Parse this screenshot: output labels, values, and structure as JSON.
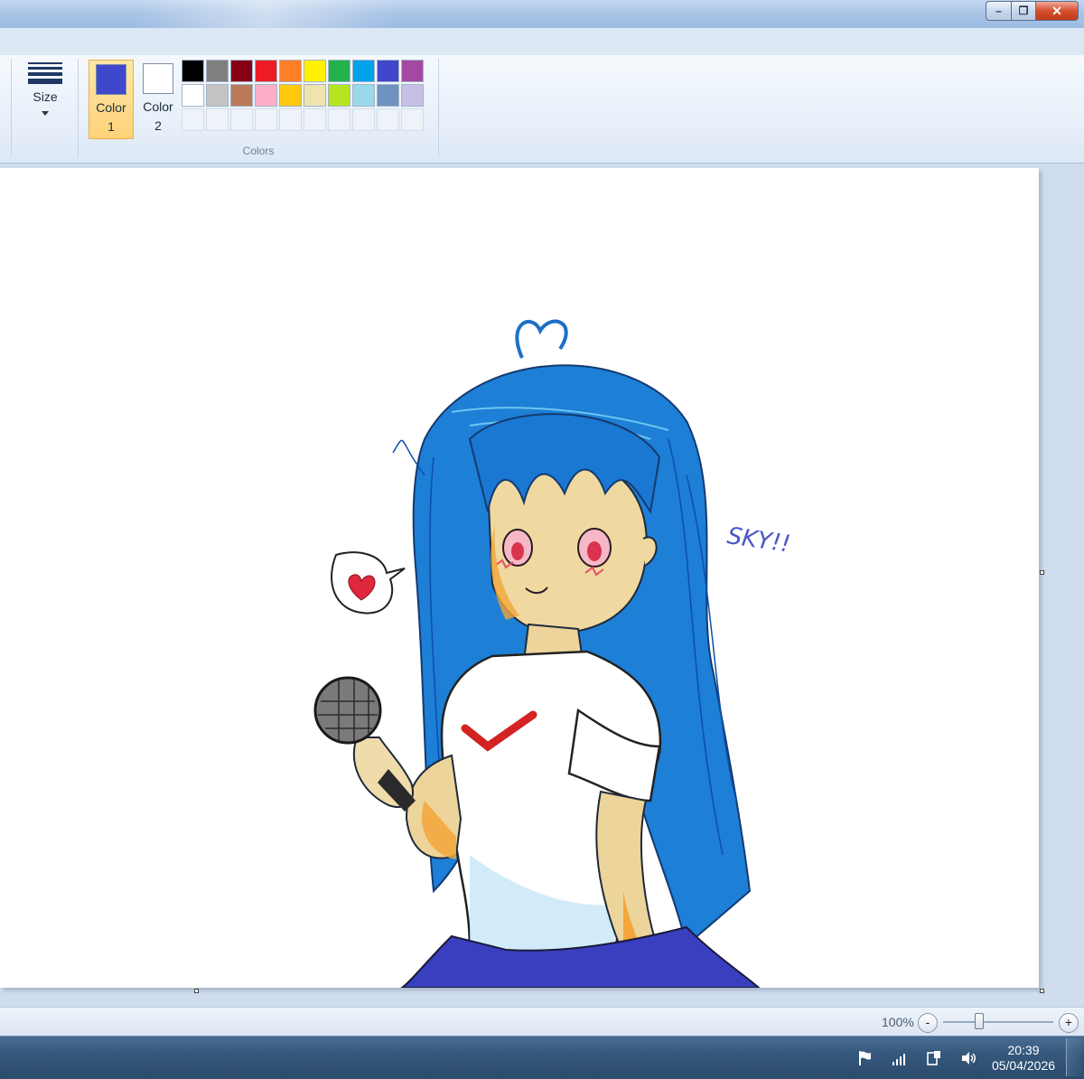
{
  "window": {
    "controls": {
      "minimize": "–",
      "maximize": "❐",
      "close": "✕"
    }
  },
  "ribbon": {
    "size_label": "Size",
    "color1": {
      "label_line1": "Color",
      "label_line2": "1",
      "value": "#3f48cc"
    },
    "color2": {
      "label_line1": "Color",
      "label_line2": "2",
      "value": "#ffffff"
    },
    "colors_group_label": "Colors",
    "palette_row1": [
      "#000000",
      "#7f7f7f",
      "#880015",
      "#ed1c24",
      "#ff7f27",
      "#fff200",
      "#22b14c",
      "#00a2e8",
      "#3f48cc",
      "#a349a4"
    ],
    "palette_row2": [
      "#ffffff",
      "#c3c3c3",
      "#b97a57",
      "#ffaec9",
      "#ffc90e",
      "#efe4b0",
      "#b5e61d",
      "#99d9ea",
      "#7092be",
      "#c8bfe7"
    ]
  },
  "canvas": {
    "drawing_text": "SKY!!"
  },
  "status": {
    "zoom_value": "100%",
    "zoom_out": "-",
    "zoom_in": "+",
    "zoom_level": 0.33
  },
  "taskbar": {
    "time": "20:39",
    "date": "05/04/2026",
    "tray": [
      "flag-icon",
      "signal-icon",
      "device-icon",
      "volume-icon"
    ]
  }
}
